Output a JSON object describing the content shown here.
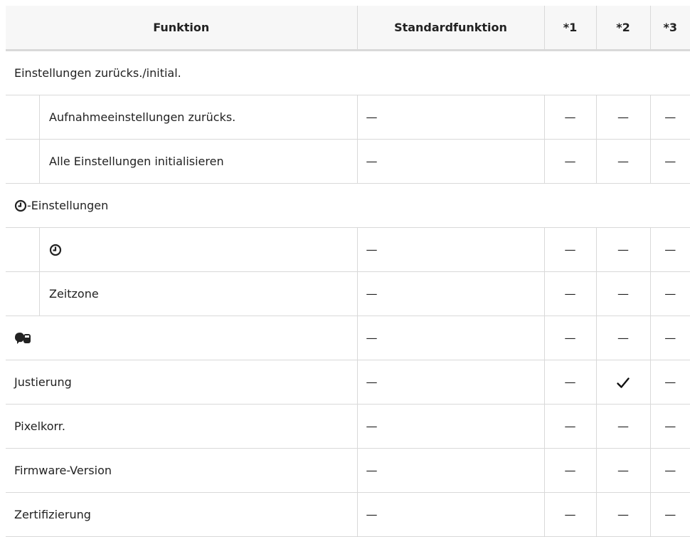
{
  "header": {
    "function": "Funktion",
    "standard": "Standardfunktion",
    "c1": "*1",
    "c2": "*2",
    "c3": "*3"
  },
  "dash": "—",
  "check": "✓",
  "sections": {
    "reset": {
      "title": "Einstellungen zurücks./initial.",
      "items": [
        {
          "label": "Aufnahmeeinstellungen zurücks."
        },
        {
          "label": "Alle Einstellungen initialisieren"
        }
      ]
    },
    "clock": {
      "title_suffix": "-Einstellungen",
      "items": [
        {
          "label": ""
        },
        {
          "label": "Zeitzone"
        }
      ]
    }
  },
  "rows": [
    {
      "label": ""
    },
    {
      "label": "Justierung"
    },
    {
      "label": "Pixelkorr."
    },
    {
      "label": "Firmware-Version"
    },
    {
      "label": "Zertifizierung"
    }
  ],
  "icons": {
    "clock": "clock-icon",
    "language": "language-icon",
    "checkmark": "checkmark-icon"
  }
}
